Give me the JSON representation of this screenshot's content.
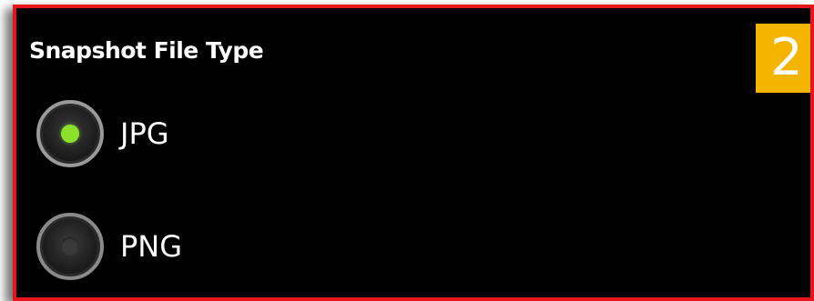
{
  "section": {
    "title": "Snapshot File Type",
    "step_number": "2"
  },
  "options": [
    {
      "label": "JPG",
      "selected": true
    },
    {
      "label": "PNG",
      "selected": false
    }
  ],
  "colors": {
    "frame_border": "#e8141c",
    "badge_background": "#f5b400",
    "selected_dot": "#8be02b",
    "background": "#000000"
  }
}
